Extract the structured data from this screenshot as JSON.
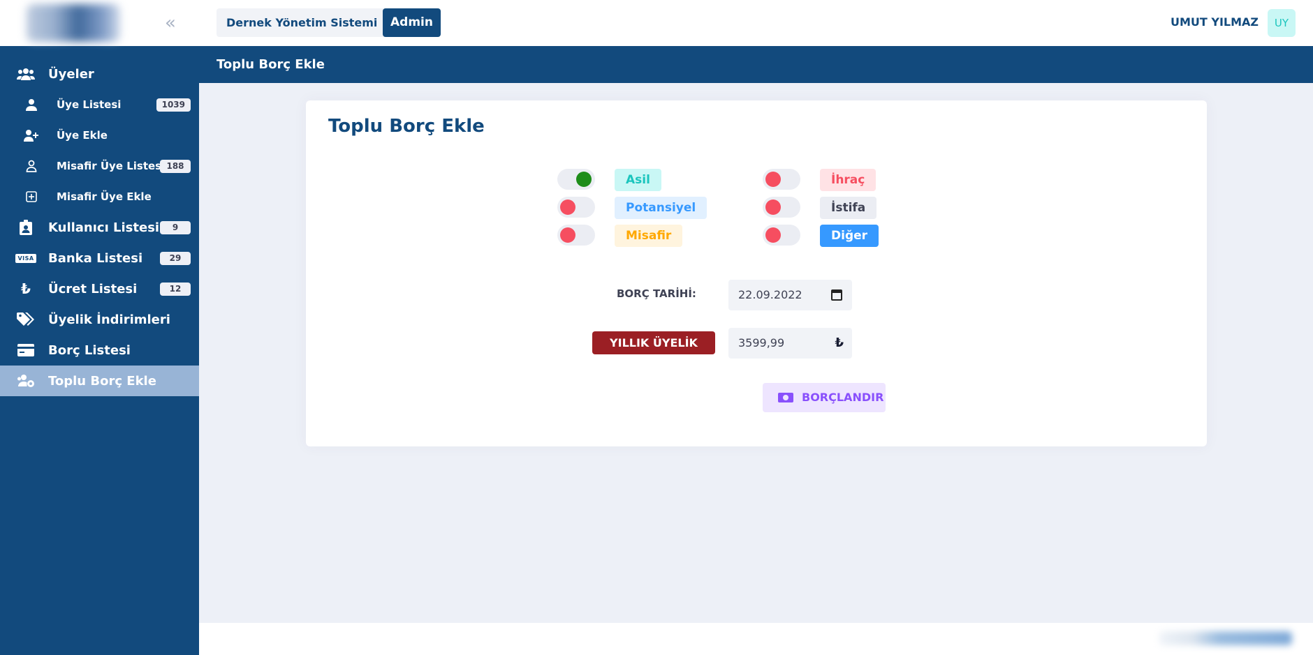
{
  "sidebar": {
    "items": [
      {
        "label": "Üyeler",
        "icon": "users-icon"
      },
      {
        "label": "Üye Listesi",
        "icon": "user-icon",
        "badge": "1039"
      },
      {
        "label": "Üye Ekle",
        "icon": "user-plus-icon"
      },
      {
        "label": "Misafir Üye Listesi",
        "icon": "user-outline-icon",
        "badge": "188"
      },
      {
        "label": "Misafir Üye Ekle",
        "icon": "plus-square-icon"
      },
      {
        "label": "Kullanıcı Listesi",
        "icon": "id-badge-icon",
        "badge": "9"
      },
      {
        "label": "Banka Listesi",
        "icon": "visa-card-icon",
        "badge": "29",
        "icon_text": "VISA"
      },
      {
        "label": "Ücret Listesi",
        "icon": "lira-icon",
        "badge": "12"
      },
      {
        "label": "Üyelik İndirimleri",
        "icon": "tags-icon"
      },
      {
        "label": "Borç Listesi",
        "icon": "credit-card-icon"
      },
      {
        "label": "Toplu Borç Ekle",
        "icon": "users-cog-icon",
        "active": true
      }
    ]
  },
  "header": {
    "system_name": "Dernek Yönetim Sistemi",
    "role": "Admin",
    "user_name": "UMUT YILMAZ",
    "user_initials": "UY"
  },
  "subheader": {
    "title": "Toplu Borç Ekle"
  },
  "card": {
    "title": "Toplu Borç Ekle",
    "statuses": [
      {
        "label": "Asil",
        "on": true
      },
      {
        "label": "Potansiyel",
        "on": false
      },
      {
        "label": "Misafir",
        "on": false
      },
      {
        "label": "İhraç",
        "on": false
      },
      {
        "label": "İstifa",
        "on": false
      },
      {
        "label": "Diğer",
        "on": false
      }
    ],
    "date_label": "BORÇ TARİHİ:",
    "date_value": "22.09.2022",
    "fee_label": "YILLIK ÜYELİK",
    "fee_value": "3599,99",
    "currency": "₺",
    "submit_label": "BORÇLANDIR"
  },
  "colors": {
    "primary": "#124a7d",
    "active_menu": "#98b4d6",
    "toggle_on": "#1e8d1a",
    "toggle_off": "#f64e60",
    "fee_button": "#9b1f24"
  }
}
